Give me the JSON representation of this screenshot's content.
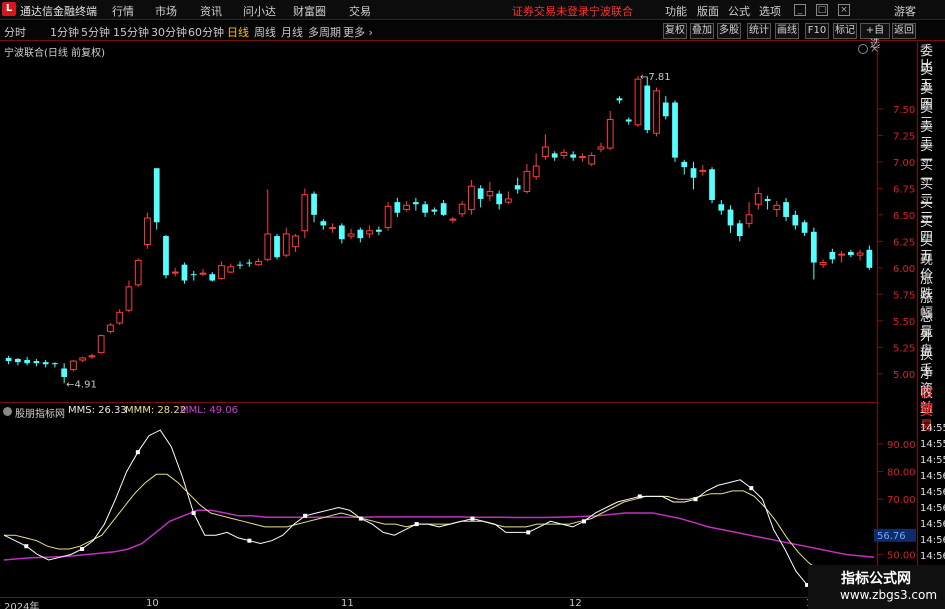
{
  "app": {
    "name": "通达信金融终端",
    "logo": "L"
  },
  "menu": [
    "行情",
    "市场",
    "资讯",
    "问小达",
    "财富圈",
    "交易"
  ],
  "login_warning": "证券交易未登录",
  "stock_title": "宁波联合",
  "right_menu": [
    "功能",
    "版面",
    "公式",
    "选项"
  ],
  "guest": "游客",
  "window_icons": [
    "minimize-icon",
    "maximize-icon",
    "close-icon"
  ],
  "period_tabs": [
    "分时",
    "1分钟",
    "5分钟",
    "15分钟",
    "30分钟",
    "60分钟",
    "日线",
    "周线",
    "月线",
    "多周期",
    "更多"
  ],
  "active_period": "日线",
  "tool_buttons": [
    "复权",
    "叠加",
    "多股",
    "统计",
    "画线",
    "F10",
    "标记",
    "+自选",
    "返回"
  ],
  "chart_header": "宁波联合(日线 前复权)",
  "indicator": {
    "name": "股朋指标网",
    "mms": "MMS: 26.33",
    "mmm": "MMM: 28.22",
    "mml": "MML: 49.06"
  },
  "price_axis": [
    "7.50",
    "7.25",
    "7.00",
    "6.75",
    "6.50",
    "6.25",
    "6.00",
    "5.75",
    "5.50",
    "5.25",
    "5.00"
  ],
  "ind_axis": [
    "90.00",
    "80.00",
    "70.00",
    "56.76",
    "50.00",
    "40.00"
  ],
  "annotations": {
    "high": "7.81",
    "low": "4.91"
  },
  "dates": [
    "2024年",
    "10",
    "11",
    "12",
    "1"
  ],
  "side_panel": [
    "委比",
    "卖五",
    "卖四",
    "卖三",
    "卖二",
    "卖一",
    "买一",
    "买二",
    "买三",
    "买四",
    "买五",
    "现价",
    "涨跌",
    "涨幅",
    "总量",
    "外盘",
    "换手",
    "净资",
    "收益"
  ],
  "side_tabs": [
    "自动",
    "交易"
  ],
  "times": [
    "14:55",
    "14:55",
    "14:55",
    "14:56",
    "14:56",
    "14:56",
    "14:56",
    "14:56",
    "14:56",
    "14:56"
  ],
  "watermark": {
    "title": "指标公式网",
    "url": "www.zbgs3.com"
  },
  "colors": {
    "up": "#ff3b3b",
    "down": "#54ffff",
    "mms": "#ffffff",
    "mmm": "#e8e090",
    "mml": "#c030c0",
    "frame": "#7a0d0d"
  },
  "chart_data": {
    "type": "candlestick",
    "candles": [
      [
        5.15,
        5.12,
        5.17,
        5.09
      ],
      [
        5.14,
        5.11,
        5.15,
        5.08
      ],
      [
        5.13,
        5.1,
        5.16,
        5.08
      ],
      [
        5.12,
        5.1,
        5.14,
        5.07
      ],
      [
        5.11,
        5.09,
        5.13,
        5.06
      ],
      [
        5.1,
        5.09,
        5.11,
        5.06
      ],
      [
        5.05,
        4.97,
        5.1,
        4.91
      ],
      [
        5.04,
        5.12,
        5.13,
        5.02
      ],
      [
        5.13,
        5.15,
        5.16,
        5.11
      ],
      [
        5.16,
        5.17,
        5.19,
        5.14
      ],
      [
        5.2,
        5.36,
        5.37,
        5.19
      ],
      [
        5.4,
        5.46,
        5.48,
        5.38
      ],
      [
        5.48,
        5.58,
        5.61,
        5.46
      ],
      [
        5.6,
        5.82,
        5.88,
        5.58
      ],
      [
        5.84,
        6.07,
        6.09,
        5.82
      ],
      [
        6.22,
        6.47,
        6.52,
        6.18
      ],
      [
        6.94,
        6.43,
        6.94,
        6.36
      ],
      [
        6.3,
        5.93,
        6.31,
        5.9
      ],
      [
        5.95,
        5.96,
        6.0,
        5.92
      ],
      [
        6.03,
        5.88,
        6.05,
        5.85
      ],
      [
        5.94,
        5.93,
        5.97,
        5.88
      ],
      [
        5.94,
        5.95,
        5.99,
        5.92
      ],
      [
        5.94,
        5.88,
        5.96,
        5.87
      ],
      [
        5.9,
        6.02,
        6.06,
        5.89
      ],
      [
        5.96,
        6.01,
        6.04,
        5.95
      ],
      [
        6.03,
        6.02,
        6.06,
        5.99
      ],
      [
        6.05,
        6.04,
        6.08,
        6.01
      ],
      [
        6.03,
        6.06,
        6.09,
        6.02
      ],
      [
        6.08,
        6.32,
        6.74,
        6.06
      ],
      [
        6.3,
        6.1,
        6.32,
        6.08
      ],
      [
        6.12,
        6.32,
        6.38,
        6.1
      ],
      [
        6.2,
        6.3,
        6.32,
        6.15
      ],
      [
        6.35,
        6.69,
        6.75,
        6.28
      ],
      [
        6.7,
        6.5,
        6.72,
        6.43
      ],
      [
        6.44,
        6.4,
        6.46,
        6.36
      ],
      [
        6.37,
        6.38,
        6.42,
        6.33
      ],
      [
        6.4,
        6.27,
        6.42,
        6.23
      ],
      [
        6.3,
        6.32,
        6.37,
        6.27
      ],
      [
        6.36,
        6.28,
        6.38,
        6.24
      ],
      [
        6.32,
        6.35,
        6.4,
        6.28
      ],
      [
        6.36,
        6.34,
        6.39,
        6.31
      ],
      [
        6.38,
        6.58,
        6.62,
        6.35
      ],
      [
        6.62,
        6.52,
        6.66,
        6.48
      ],
      [
        6.55,
        6.59,
        6.63,
        6.53
      ],
      [
        6.62,
        6.6,
        6.66,
        6.54
      ],
      [
        6.6,
        6.52,
        6.63,
        6.48
      ],
      [
        6.55,
        6.53,
        6.57,
        6.5
      ],
      [
        6.61,
        6.5,
        6.64,
        6.49
      ],
      [
        6.45,
        6.46,
        6.48,
        6.42
      ],
      [
        6.51,
        6.6,
        6.63,
        6.48
      ],
      [
        6.55,
        6.77,
        6.83,
        6.5
      ],
      [
        6.75,
        6.65,
        6.78,
        6.57
      ],
      [
        6.68,
        6.72,
        6.81,
        6.63
      ],
      [
        6.7,
        6.6,
        6.73,
        6.55
      ],
      [
        6.62,
        6.65,
        6.72,
        6.6
      ],
      [
        6.78,
        6.74,
        6.85,
        6.7
      ],
      [
        6.72,
        6.91,
        6.98,
        6.7
      ],
      [
        6.86,
        6.96,
        7.08,
        6.83
      ],
      [
        7.05,
        7.14,
        7.26,
        7.02
      ],
      [
        7.08,
        7.04,
        7.1,
        7.01
      ],
      [
        7.06,
        7.09,
        7.12,
        7.03
      ],
      [
        7.07,
        7.04,
        7.1,
        7.01
      ],
      [
        7.04,
        7.05,
        7.08,
        7.0
      ],
      [
        6.98,
        7.06,
        7.09,
        6.96
      ],
      [
        7.12,
        7.14,
        7.18,
        7.09
      ],
      [
        7.13,
        7.4,
        7.48,
        7.11
      ],
      [
        7.6,
        7.58,
        7.62,
        7.55
      ],
      [
        7.4,
        7.38,
        7.42,
        7.35
      ],
      [
        7.35,
        7.78,
        7.81,
        7.33
      ],
      [
        7.72,
        7.3,
        7.8,
        7.27
      ],
      [
        7.27,
        7.67,
        7.7,
        7.24
      ],
      [
        7.56,
        7.43,
        7.62,
        7.4
      ],
      [
        7.56,
        7.04,
        7.58,
        7.0
      ],
      [
        7.0,
        6.95,
        7.02,
        6.88
      ],
      [
        6.94,
        6.85,
        7.0,
        6.74
      ],
      [
        6.91,
        6.92,
        6.97,
        6.87
      ],
      [
        6.93,
        6.64,
        6.95,
        6.61
      ],
      [
        6.6,
        6.54,
        6.64,
        6.5
      ],
      [
        6.55,
        6.4,
        6.59,
        6.33
      ],
      [
        6.42,
        6.3,
        6.45,
        6.25
      ],
      [
        6.42,
        6.5,
        6.62,
        6.38
      ],
      [
        6.6,
        6.7,
        6.76,
        6.55
      ],
      [
        6.65,
        6.63,
        6.68,
        6.55
      ],
      [
        6.55,
        6.59,
        6.63,
        6.48
      ],
      [
        6.62,
        6.48,
        6.66,
        6.44
      ],
      [
        6.5,
        6.4,
        6.54,
        6.36
      ],
      [
        6.43,
        6.33,
        6.45,
        6.3
      ],
      [
        6.34,
        6.05,
        6.38,
        5.89
      ],
      [
        6.03,
        6.05,
        6.08,
        6.0
      ],
      [
        6.15,
        6.08,
        6.18,
        6.04
      ],
      [
        6.12,
        6.13,
        6.16,
        6.05
      ],
      [
        6.15,
        6.12,
        6.17,
        6.1
      ],
      [
        6.12,
        6.14,
        6.17,
        6.07
      ],
      [
        6.17,
        6.0,
        6.21,
        5.98
      ]
    ],
    "mms": [
      57,
      55,
      53,
      50,
      48,
      49,
      50,
      52,
      55,
      61,
      70,
      80,
      87,
      93,
      95,
      89,
      78,
      65,
      57,
      57,
      58,
      56,
      55,
      54,
      55,
      57,
      61,
      64,
      65,
      66,
      67,
      66,
      63,
      61,
      58,
      57,
      59,
      61,
      61,
      60,
      61,
      62,
      63,
      62,
      61,
      58,
      58,
      58,
      60,
      62,
      61,
      60,
      62,
      65,
      67,
      69,
      70,
      71,
      71,
      71,
      69,
      69,
      70,
      73,
      75,
      76,
      77,
      74,
      70,
      59,
      52,
      44,
      39,
      35,
      36,
      39,
      38,
      35,
      30
    ],
    "mmm": [
      57,
      57,
      56,
      55,
      53,
      52,
      52,
      53,
      55,
      57,
      62,
      67,
      72,
      76,
      79,
      79,
      76,
      72,
      68,
      65,
      64,
      63,
      62,
      61,
      60,
      60,
      60,
      61,
      62,
      63,
      64,
      65,
      64,
      63,
      62,
      61,
      61,
      60,
      61,
      61,
      61,
      61,
      62,
      62,
      62,
      61,
      60,
      60,
      60,
      61,
      61,
      61,
      61,
      62,
      63,
      65,
      67,
      69,
      70,
      71,
      71,
      71,
      70,
      70,
      71,
      72,
      72,
      73,
      73,
      71,
      67,
      62,
      56,
      51,
      47,
      44,
      41,
      40,
      38,
      37,
      35
    ],
    "mml": [
      48,
      48.5,
      48.8,
      49,
      49.2,
      49.5,
      50,
      50.5,
      51,
      52,
      54,
      58,
      62,
      64,
      66,
      66,
      65,
      64,
      64,
      63.5,
      63.5,
      63.5,
      63.5,
      63.5,
      63.5,
      63.5,
      63.5,
      63.6,
      63.6,
      63.6,
      63.6,
      63.6,
      63.6,
      63.6,
      63.5,
      63.5,
      63.5,
      63.4,
      63.4,
      63.4,
      63.5,
      63.6,
      63.8,
      64,
      64.5,
      65,
      65,
      65,
      64,
      63,
      61.5,
      60,
      59,
      58,
      57,
      56,
      55,
      54,
      53,
      52,
      51,
      50,
      49.5,
      49
    ],
    "price_range": [
      4.8,
      7.98
    ],
    "ind_range": [
      35,
      99
    ]
  }
}
